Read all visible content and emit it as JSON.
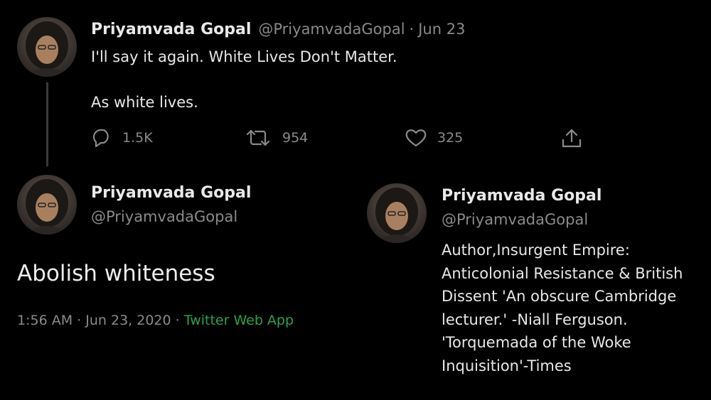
{
  "tweet": {
    "author_name": "Priyamvada Gopal",
    "author_handle": "@PriyamvadaGopal",
    "separator": "·",
    "date": "Jun 23",
    "line1": "I'll say it again. White Lives Don't Matter.",
    "line2": "As white lives.",
    "replies": "1.5K",
    "retweets": "954",
    "likes": "325"
  },
  "reply_tweet": {
    "author_name": "Priyamvada Gopal",
    "author_handle": "@PriyamvadaGopal",
    "text": "Abolish whiteness",
    "time": "1:56 AM",
    "date": "Jun 23, 2020",
    "separator": "·",
    "source": "Twitter Web App"
  },
  "profile": {
    "name": "Priyamvada Gopal",
    "handle": "@PriyamvadaGopal",
    "bio_lines": [
      "Author,Insurgent Empire:",
      "Anticolonial Resistance & British",
      "Dissent 'An obscure Cambridge",
      "lecturer.' -Niall Ferguson.",
      "'Torquemada of the Woke",
      "Inquisition'-Times"
    ]
  },
  "colors": {
    "background": "#000000",
    "source_link": "#2aa34a",
    "muted": "#8a8a8a"
  },
  "icons": [
    "reply-icon",
    "retweet-icon",
    "like-icon",
    "share-icon"
  ]
}
